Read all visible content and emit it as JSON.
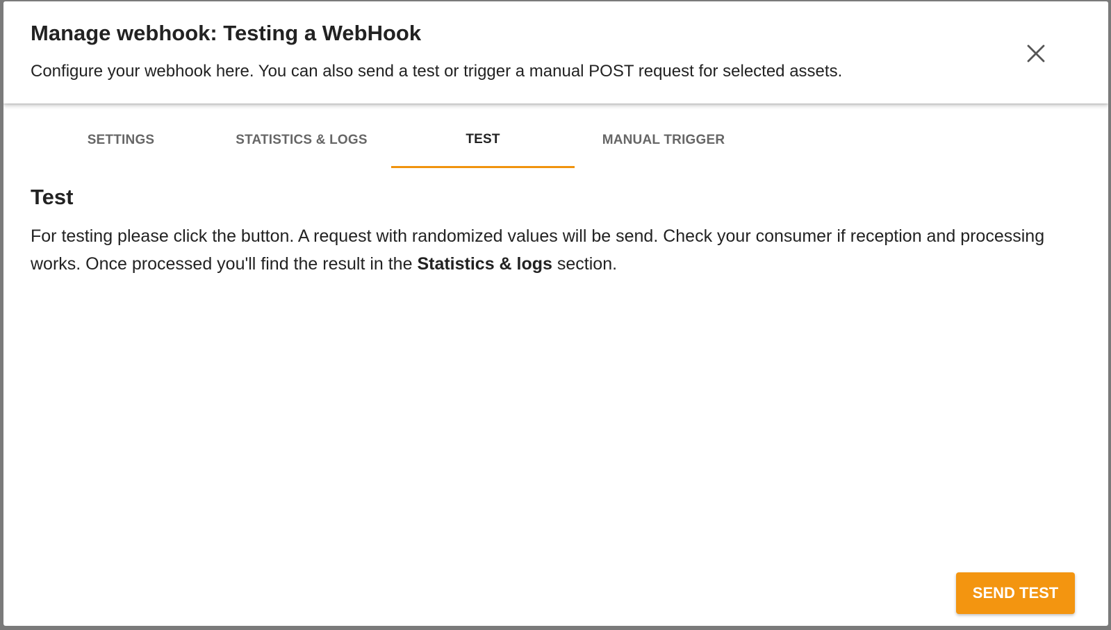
{
  "dialog": {
    "title": "Manage webhook: Testing a WebHook",
    "subtitle": "Configure your webhook here. You can also send a test or trigger a manual POST request for selected assets.",
    "close_icon": "close-icon"
  },
  "tabs": [
    {
      "label": "SETTINGS",
      "active": false
    },
    {
      "label": "STATISTICS & LOGS",
      "active": false
    },
    {
      "label": "TEST",
      "active": true
    },
    {
      "label": "MANUAL TRIGGER",
      "active": false
    }
  ],
  "test_section": {
    "title": "Test",
    "text_before": "For testing please click the button. A request with randomized values will be send. Check your consumer if reception and processing works. Once processed you'll find the result in the ",
    "text_bold": "Statistics & logs",
    "text_after": " section."
  },
  "actions": {
    "send_test_label": "SEND TEST"
  },
  "colors": {
    "accent": "#f39510",
    "tab_indicator": "#f0930e",
    "text_primary": "#222222",
    "tab_inactive": "#666666"
  }
}
